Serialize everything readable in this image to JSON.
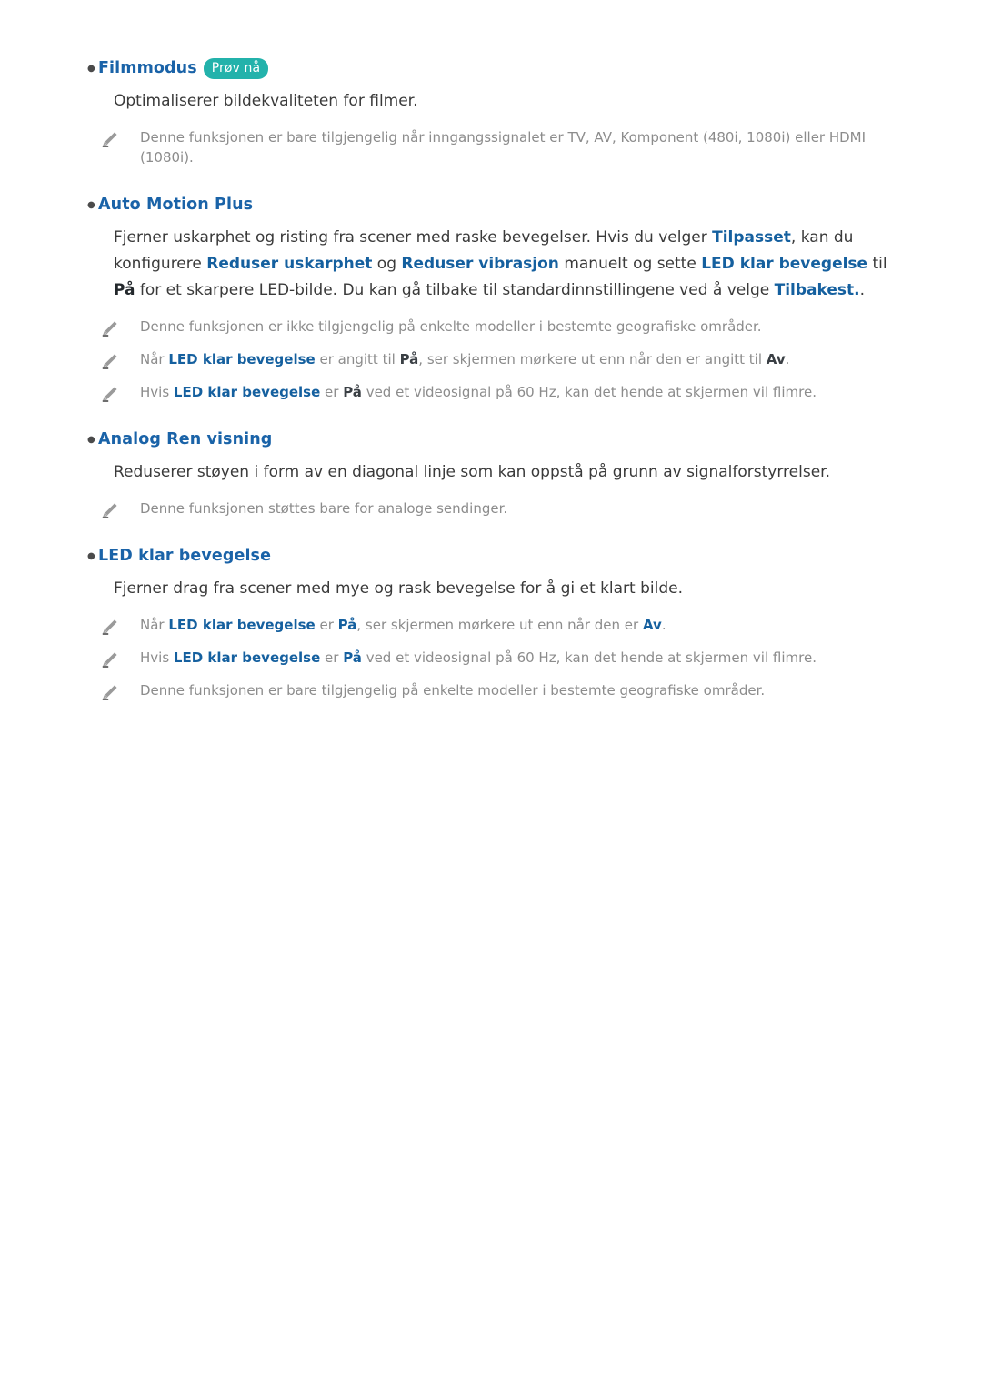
{
  "document": {
    "language": "no",
    "colors": {
      "heading_blue": "#1a63a8",
      "badge_teal": "#23b2ab",
      "body_text": "#3a3a3a",
      "note_text": "#8c8c8c",
      "term_blue": "#15609f",
      "background": "#ffffff"
    }
  },
  "sections": [
    {
      "id": "filmmodus",
      "heading": "Filmmodus",
      "badge": "Prøv nå",
      "body": "Optimaliserer bildekvaliteten for filmer.",
      "notes": [
        "Denne funksjonen er bare tilgjengelig når inngangssignalet er TV, AV, Komponent (480i, 1080i) eller HDMI (1080i)."
      ]
    },
    {
      "id": "auto-motion-plus",
      "heading": "Auto Motion Plus",
      "badge": "",
      "body_parts": {
        "p1": "Fjerner uskarphet og risting fra scener med raske bevegelser. Hvis du velger ",
        "t1": "Tilpasset",
        "p2": ", kan du konfigurere ",
        "t2": "Reduser uskarphet",
        "p3": " og ",
        "t3": "Reduser vibrasjon",
        "p4": " manuelt og sette ",
        "t4": "LED klar bevegelse",
        "p5": " til ",
        "t5": "På",
        "p6": " for et skarpere LED-bilde. Du kan gå tilbake til standardinnstillingene ved å velge ",
        "t6": "Tilbakest.",
        "p7": "."
      },
      "notes": [
        {
          "parts": [
            {
              "text": "Denne funksjonen er ikke tilgjengelig på enkelte modeller i bestemte geografiske områder.",
              "style": "plain"
            }
          ]
        },
        {
          "parts": [
            {
              "text": "Når ",
              "style": "plain"
            },
            {
              "text": "LED klar bevegelse",
              "style": "blue"
            },
            {
              "text": " er angitt til ",
              "style": "plain"
            },
            {
              "text": "På",
              "style": "dark"
            },
            {
              "text": ", ser skjermen mørkere ut enn når den er angitt til ",
              "style": "plain"
            },
            {
              "text": "Av",
              "style": "dark"
            },
            {
              "text": ".",
              "style": "plain"
            }
          ]
        },
        {
          "parts": [
            {
              "text": "Hvis ",
              "style": "plain"
            },
            {
              "text": "LED klar bevegelse",
              "style": "blue"
            },
            {
              "text": " er ",
              "style": "plain"
            },
            {
              "text": "På",
              "style": "dark"
            },
            {
              "text": " ved et videosignal på 60 Hz, kan det hende at skjermen vil flimre.",
              "style": "plain"
            }
          ]
        }
      ]
    },
    {
      "id": "analog-ren-visning",
      "heading": "Analog Ren visning",
      "badge": "",
      "body": "Reduserer støyen i form av en diagonal linje som kan oppstå på grunn av signalforstyrrelser.",
      "notes": [
        "Denne funksjonen støttes bare for analoge sendinger."
      ]
    },
    {
      "id": "led-klar-bevegelse",
      "heading": "LED klar bevegelse",
      "badge": "",
      "body": "Fjerner drag fra scener med mye og rask bevegelse for å gi et klart bilde.",
      "notes": [
        {
          "parts": [
            {
              "text": "Når ",
              "style": "plain"
            },
            {
              "text": "LED klar bevegelse",
              "style": "blue"
            },
            {
              "text": " er ",
              "style": "plain"
            },
            {
              "text": "På",
              "style": "blue"
            },
            {
              "text": ", ser skjermen mørkere ut enn når den er ",
              "style": "plain"
            },
            {
              "text": "Av",
              "style": "blue"
            },
            {
              "text": ".",
              "style": "plain"
            }
          ]
        },
        {
          "parts": [
            {
              "text": "Hvis ",
              "style": "plain"
            },
            {
              "text": "LED klar bevegelse",
              "style": "blue"
            },
            {
              "text": " er ",
              "style": "plain"
            },
            {
              "text": "På",
              "style": "blue"
            },
            {
              "text": " ved et videosignal på 60 Hz, kan det hende at skjermen vil flimre.",
              "style": "plain"
            }
          ]
        },
        {
          "parts": [
            {
              "text": "Denne funksjonen er bare tilgjengelig på enkelte modeller i bestemte geografiske områder.",
              "style": "plain"
            }
          ]
        }
      ]
    }
  ],
  "icons": {
    "note": "pencil-icon",
    "bullet": "bullet-dot-icon"
  }
}
